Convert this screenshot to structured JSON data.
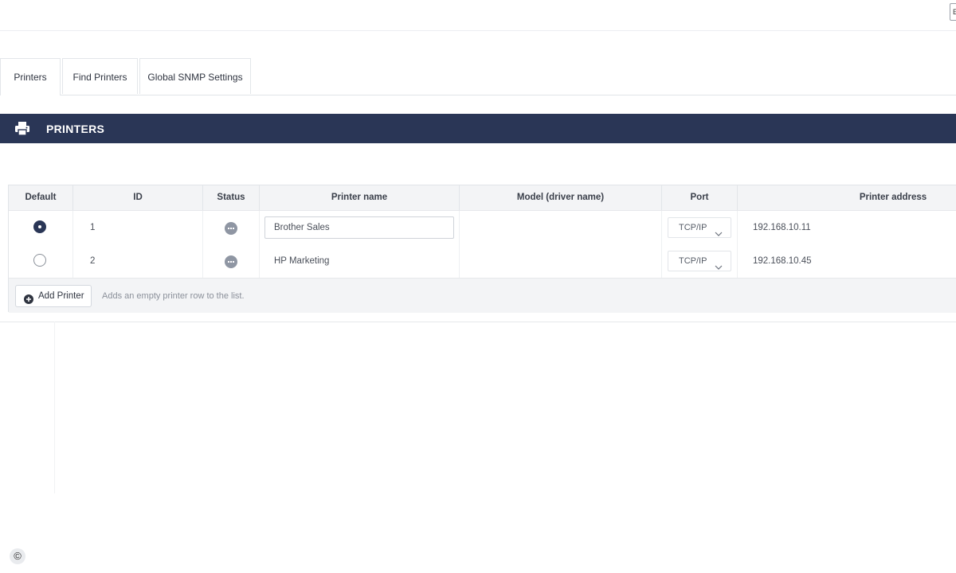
{
  "topbar": {
    "corner_label": "E"
  },
  "tabs": [
    {
      "label": "Printers",
      "active": true
    },
    {
      "label": "Find Printers",
      "active": false
    },
    {
      "label": "Global SNMP Settings",
      "active": false
    }
  ],
  "section": {
    "title": "PRINTERS",
    "icon": "printer-icon"
  },
  "table": {
    "columns": [
      "Default",
      "ID",
      "Status",
      "Printer name",
      "Model (driver name)",
      "Port",
      "Printer address"
    ],
    "rows": [
      {
        "default": true,
        "id": "1",
        "status": "unknown",
        "name": "Brother Sales",
        "model": "",
        "port": "TCP/IP",
        "address": "192.168.10.11"
      },
      {
        "default": false,
        "id": "2",
        "status": "unknown",
        "name": "HP Marketing",
        "model": "",
        "port": "TCP/IP",
        "address": "192.168.10.45"
      }
    ]
  },
  "footer": {
    "add_button_label": "Add Printer",
    "hint": "Adds an empty printer row to the list."
  },
  "copyright_symbol": "©",
  "colors": {
    "header_bar": "#2a3656",
    "status_dot": "#8f96a3"
  }
}
